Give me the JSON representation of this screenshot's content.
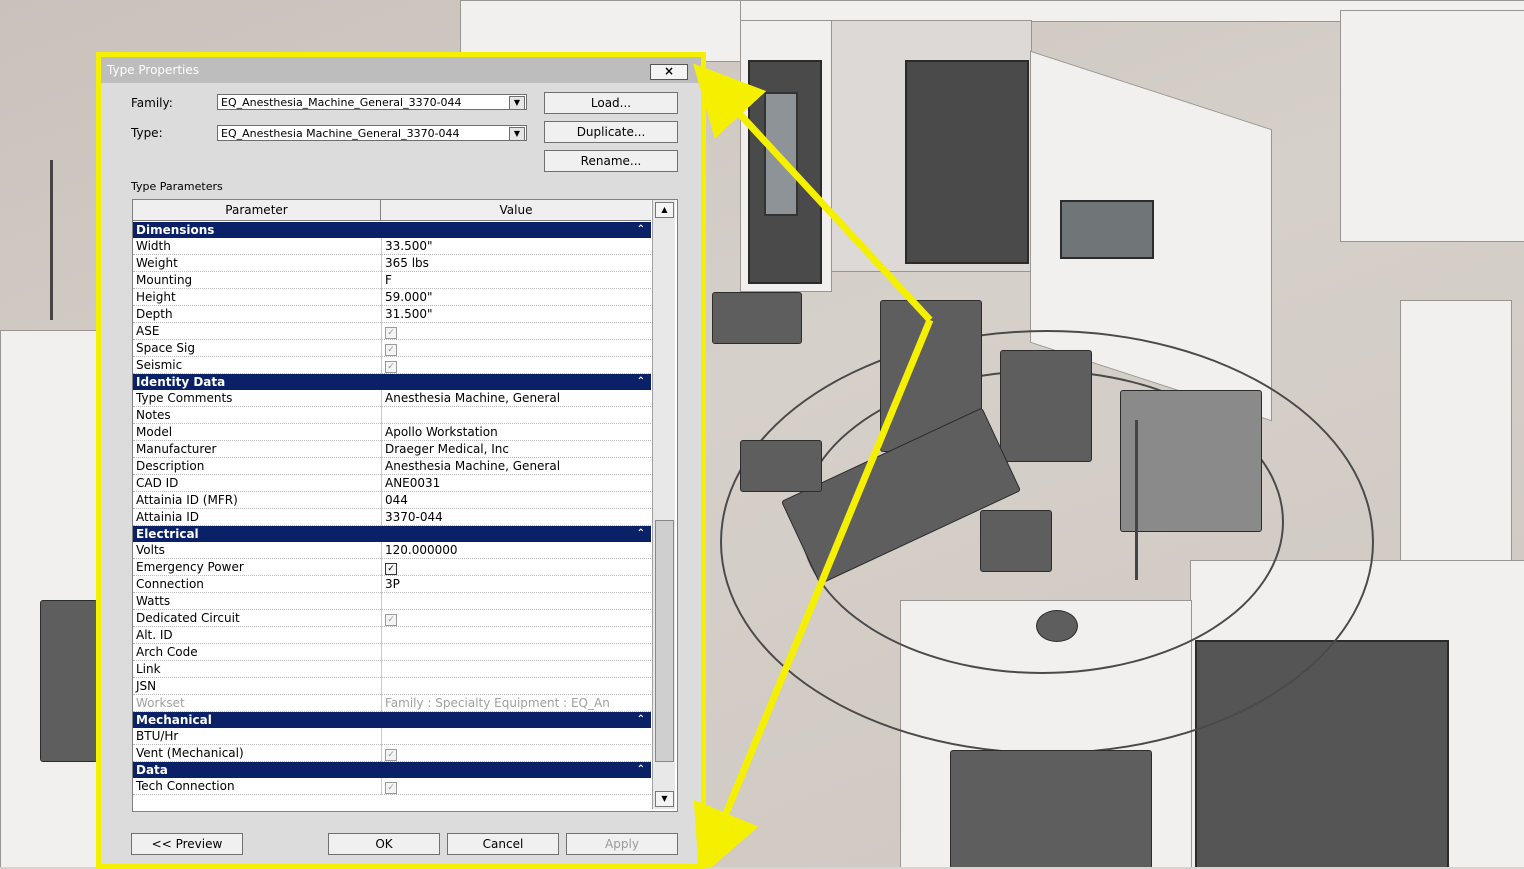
{
  "dialog": {
    "title": "Type Properties",
    "close_label": "×",
    "family_label": "Family:",
    "family_value": "EQ_Anesthesia_Machine_General_3370-044",
    "type_label": "Type:",
    "type_value": "EQ_Anesthesia Machine_General_3370-044",
    "load_label": "Load...",
    "duplicate_label": "Duplicate...",
    "rename_label": "Rename...",
    "type_parameters_label": "Type Parameters",
    "preview_label": "<< Preview",
    "ok_label": "OK",
    "cancel_label": "Cancel",
    "apply_label": "Apply"
  },
  "grid": {
    "col_parameter": "Parameter",
    "col_value": "Value",
    "groups": [
      {
        "name": "Dimensions",
        "rows": [
          {
            "p": "Width",
            "v": "33.500\""
          },
          {
            "p": "Weight",
            "v": "365 lbs"
          },
          {
            "p": "Mounting",
            "v": "F"
          },
          {
            "p": "Height",
            "v": "59.000\""
          },
          {
            "p": "Depth",
            "v": "31.500\""
          },
          {
            "p": "ASE",
            "v": "",
            "checkbox": "disabled"
          },
          {
            "p": "Space Sig",
            "v": "",
            "checkbox": "disabled"
          },
          {
            "p": "Seismic",
            "v": "",
            "checkbox": "disabled"
          }
        ]
      },
      {
        "name": "Identity Data",
        "rows": [
          {
            "p": "Type Comments",
            "v": "Anesthesia Machine, General"
          },
          {
            "p": "Notes",
            "v": ""
          },
          {
            "p": "Model",
            "v": "Apollo Workstation"
          },
          {
            "p": "Manufacturer",
            "v": "Draeger Medical, Inc"
          },
          {
            "p": "Description",
            "v": "Anesthesia Machine, General"
          },
          {
            "p": "CAD ID",
            "v": "ANE0031"
          },
          {
            "p": "Attainia ID (MFR)",
            "v": "044"
          },
          {
            "p": "Attainia ID",
            "v": "3370-044"
          }
        ]
      },
      {
        "name": "Electrical",
        "rows": [
          {
            "p": "Volts",
            "v": "120.000000"
          },
          {
            "p": "Emergency Power",
            "v": "",
            "checkbox": "on"
          },
          {
            "p": "Connection",
            "v": "3P"
          },
          {
            "p": "Watts",
            "v": ""
          },
          {
            "p": "Dedicated Circuit",
            "v": "",
            "checkbox": "disabled"
          },
          {
            "p": "Alt. ID",
            "v": ""
          },
          {
            "p": "Arch Code",
            "v": ""
          },
          {
            "p": "Link",
            "v": ""
          },
          {
            "p": "JSN",
            "v": ""
          },
          {
            "p": "Workset",
            "v": "Family : Specialty Equipment : EQ_An",
            "dim": true
          }
        ]
      },
      {
        "name": "Mechanical",
        "rows": [
          {
            "p": "BTU/Hr",
            "v": ""
          },
          {
            "p": "Vent (Mechanical)",
            "v": "",
            "checkbox": "disabled"
          }
        ]
      },
      {
        "name": "Data",
        "rows": [
          {
            "p": "Tech Connection",
            "v": "",
            "checkbox": "disabled"
          }
        ]
      }
    ]
  },
  "colors": {
    "highlight": "#f4f000",
    "group_header": "#0a2167"
  },
  "icons": {
    "close": "close-icon",
    "dropdown": "chevron-down-icon",
    "collapse": "chevron-up-double-icon",
    "check": "checkmark-icon"
  }
}
